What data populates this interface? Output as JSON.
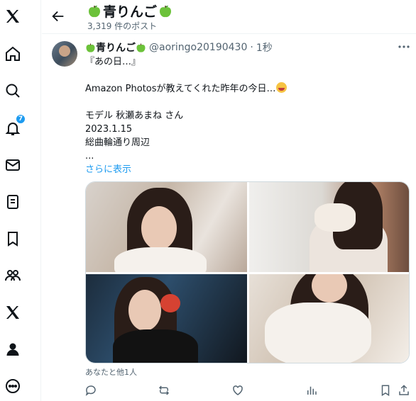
{
  "nav": {
    "items": [
      {
        "name": "x-logo-icon",
        "icon": "x-logo"
      },
      {
        "name": "home-icon",
        "icon": "home"
      },
      {
        "name": "explore-icon",
        "icon": "search"
      },
      {
        "name": "notifications-icon",
        "icon": "bell",
        "badge": "7"
      },
      {
        "name": "messages-icon",
        "icon": "envelope"
      },
      {
        "name": "lists-icon",
        "icon": "list"
      },
      {
        "name": "bookmarks-icon",
        "icon": "bookmark"
      },
      {
        "name": "communities-icon",
        "icon": "people"
      },
      {
        "name": "premium-icon",
        "icon": "x-logo"
      },
      {
        "name": "profile-icon",
        "icon": "person"
      },
      {
        "name": "more-icon",
        "icon": "more-circle"
      }
    ]
  },
  "header": {
    "title": "青りんご",
    "post_count": "3,319 件のポスト"
  },
  "tweet": {
    "display_name": "青りんご",
    "handle": "@aoringo20190430",
    "separator": "·",
    "time": "1秒",
    "lines": [
      "『あの日…』",
      "",
      "Amazon Photosが教えてくれた昨年の今日…",
      "",
      "モデル 秋瀬あまね さん",
      "2023.1.15",
      "総曲輪通り周辺",
      "..."
    ],
    "show_more": "さらに表示",
    "liked_by": "あなたと他1人"
  },
  "colors": {
    "accent": "#1d9bf0",
    "text": "#0f1419",
    "muted": "#536471",
    "border": "#eff3f4"
  }
}
